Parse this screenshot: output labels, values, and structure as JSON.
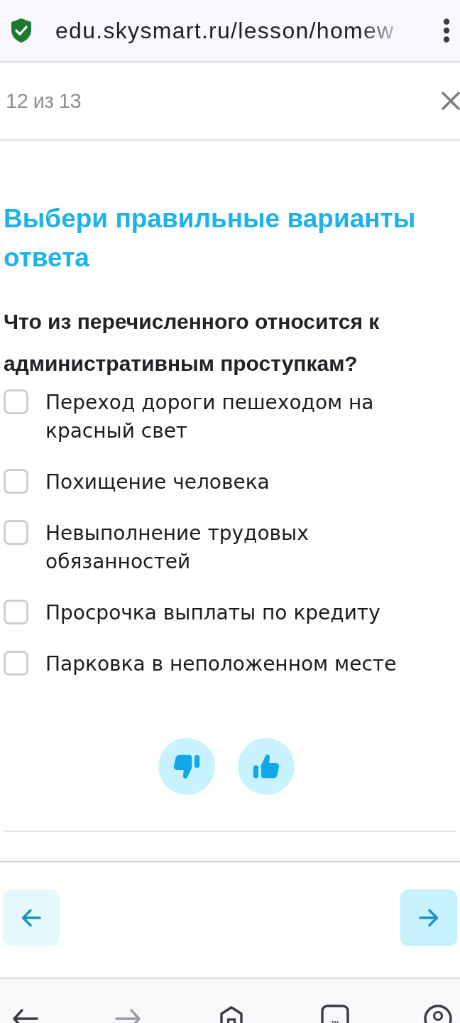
{
  "browser_bar": {
    "url": "edu.skysmart.ru/lesson/homew",
    "secure": true
  },
  "header": {
    "counter": "12 из 13"
  },
  "task": {
    "title": "Выбери правильные варианты ответа",
    "question": "Что из перечисленного относится к административным проступкам?",
    "options": [
      {
        "label": "Переход дороги пешеходом на красный свет",
        "checked": false
      },
      {
        "label": "Похищение человека",
        "checked": false
      },
      {
        "label": "Невыполнение трудовых обязанностей",
        "checked": false
      },
      {
        "label": "Просрочка выплаты по кредиту",
        "checked": false
      },
      {
        "label": "Парковка в неположенном месте",
        "checked": false
      }
    ]
  },
  "feedback": [
    {
      "kind": "dislike"
    },
    {
      "kind": "like"
    }
  ],
  "lesson_nav": [
    {
      "kind": "back"
    },
    {
      "kind": "forward"
    }
  ],
  "browser_nav": [
    {
      "kind": "back",
      "disabled": false
    },
    {
      "kind": "forward",
      "disabled": true
    },
    {
      "kind": "home"
    },
    {
      "kind": "tabs"
    },
    {
      "kind": "account"
    }
  ]
}
